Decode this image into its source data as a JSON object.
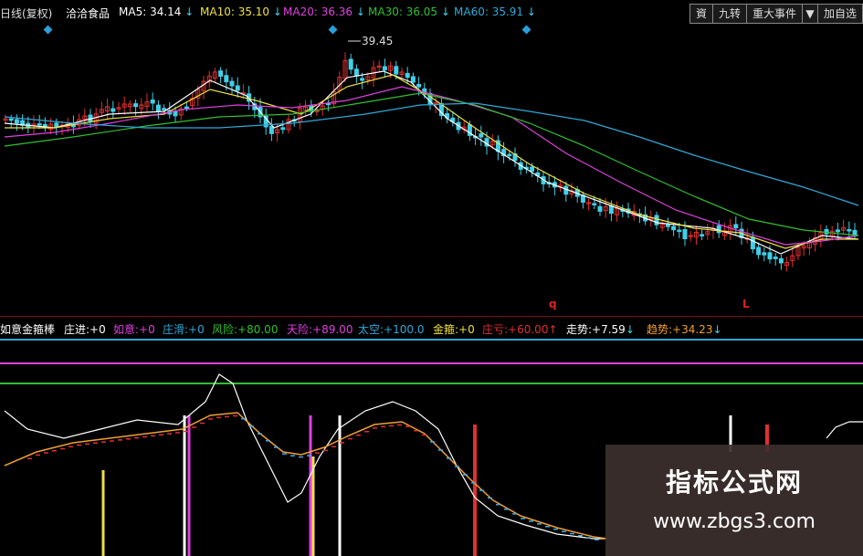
{
  "header": {
    "period": "日线(复权)",
    "stock_name": "洽洽食品",
    "ma": [
      {
        "label": "MA5:",
        "value": "34.14",
        "arrow": "↓",
        "color": "#ffffff"
      },
      {
        "label": "MA10:",
        "value": "35.10",
        "arrow": "↓",
        "color": "#f0e040"
      },
      {
        "label": "MA20:",
        "value": "36.36",
        "arrow": "↓",
        "color": "#e040e0"
      },
      {
        "label": "MA30:",
        "value": "36.05",
        "arrow": "↓",
        "color": "#30c030"
      },
      {
        "label": "MA60:",
        "value": "35.91",
        "arrow": "↓",
        "color": "#30a8d8"
      }
    ],
    "buttons": [
      "資",
      "九转",
      "重大事件",
      "▼",
      "加自选"
    ]
  },
  "price_label": "39.45",
  "markers": [
    "q",
    "L"
  ],
  "indicator": {
    "name": "如意金箍棒",
    "items": [
      {
        "label": "庄进:",
        "value": "+0",
        "color": "#ffffff"
      },
      {
        "label": "如意:",
        "value": "+0",
        "color": "#e040e0"
      },
      {
        "label": "庄滑:",
        "value": "+0",
        "color": "#30a8d8"
      },
      {
        "label": "风险:",
        "value": "+80.00",
        "color": "#30c030"
      },
      {
        "label": "天险:",
        "value": "+89.00",
        "color": "#e040e0"
      },
      {
        "label": "太空:",
        "value": "+100.0",
        "color": "#30a8d8"
      },
      {
        "label": "金箍:",
        "value": "+0",
        "color": "#f0e040"
      },
      {
        "label": "庄亏:",
        "value": "+60.00",
        "arrow": "↑",
        "color": "#e03030"
      },
      {
        "label": "走势:",
        "value": "+7.59",
        "arrow": "↓",
        "color": "#ffffff"
      },
      {
        "label": "趋势:",
        "value": "+34.23",
        "arrow": "↓",
        "color": "#f0a030"
      }
    ]
  },
  "watermark": {
    "title": "指标公式网",
    "url": "www.zbgs3.com"
  },
  "colors": {
    "up": "#e03030",
    "down": "#40d0e8",
    "ma5": "#ffffff",
    "ma10": "#f0e040",
    "ma20": "#e040e0",
    "ma30": "#30c030",
    "ma60": "#30a8d8"
  }
}
